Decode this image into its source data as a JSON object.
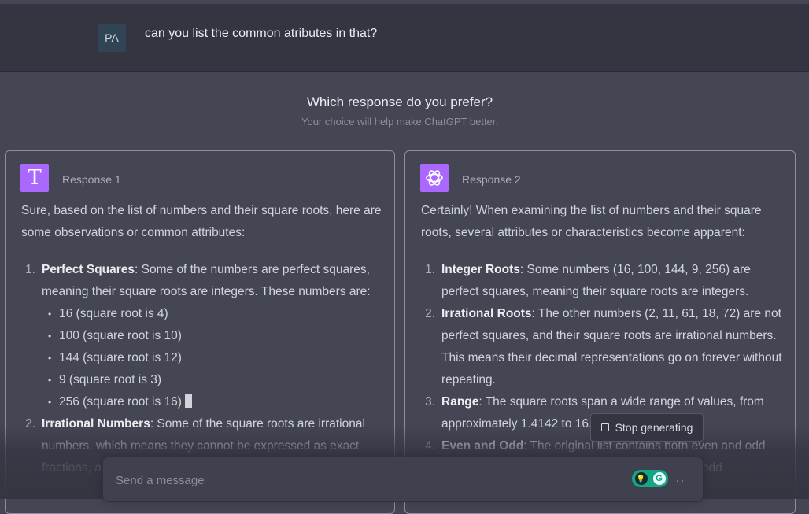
{
  "user": {
    "avatar": "PA",
    "message": "can you list the common atributes in that?"
  },
  "preference": {
    "title": "Which response do you prefer?",
    "subtitle": "Your choice will help make ChatGPT better."
  },
  "response1": {
    "label": "Response 1",
    "icon": "letter-t-icon",
    "icon_glyph": "T",
    "icon_color": "#ab68ff",
    "intro": "Sure, based on the list of numbers and their square roots, here are some observations or common attributes:",
    "items": [
      {
        "num": "1.",
        "title": "Perfect Squares",
        "text": ": Some of the numbers are perfect squares, meaning their square roots are integers. These numbers are:",
        "sub": [
          "16 (square root is 4)",
          "100 (square root is 10)",
          "144 (square root is 12)",
          "9 (square root is 3)",
          "256 (square root is 16)"
        ]
      },
      {
        "num": "2.",
        "title": "Irrational Numbers",
        "text": ": Some of the square roots are irrational numbers, which means they cannot be expressed as exact fractions, and"
      }
    ]
  },
  "response2": {
    "label": "Response 2",
    "icon": "openai-logo-icon",
    "icon_color": "#ab68ff",
    "intro": "Certainly! When examining the list of numbers and their square roots, several attributes or characteristics become apparent:",
    "items": [
      {
        "num": "1.",
        "title": "Integer Roots",
        "text": ": Some numbers (16, 100, 144, 9, 256) are perfect squares, meaning their square roots are integers."
      },
      {
        "num": "2.",
        "title": "Irrational Roots",
        "text": ": The other numbers (2, 11, 61, 18, 72) are not perfect squares, and their square roots are irrational numbers. This means their decimal representations go on forever without repeating."
      },
      {
        "num": "3.",
        "title": "Range",
        "text": ": The square roots span a wide range of values, from approximately 1.4142 to 16."
      },
      {
        "num": "4.",
        "title": "Even and Odd",
        "text": ": The original list contains both even and odd numbers, and their square roots can be even or odd"
      }
    ]
  },
  "stop_button": {
    "label": "Stop generating",
    "icon": "stop-square-icon"
  },
  "composer": {
    "placeholder": "Send a message",
    "send_indicator": "..",
    "extension_icons": [
      "grammar-extension-icon",
      "grammarly-icon"
    ],
    "extension_glyph_a": "💡",
    "extension_glyph_b": "G"
  }
}
